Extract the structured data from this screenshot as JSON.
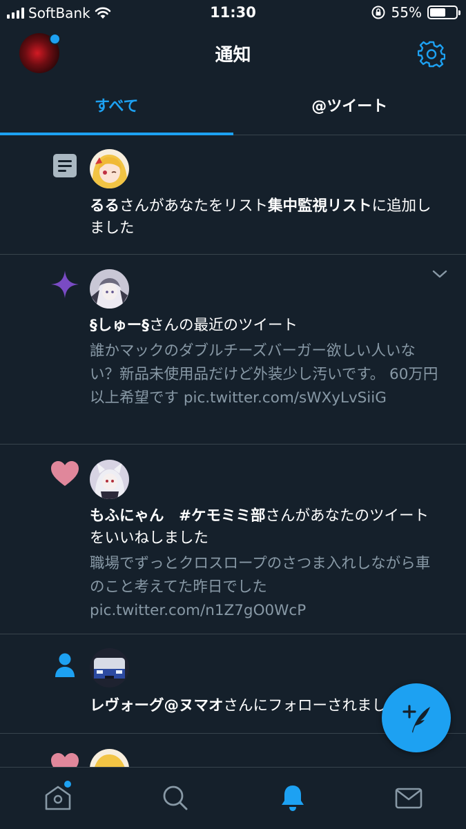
{
  "status_bar": {
    "carrier": "SoftBank",
    "time": "11:30",
    "battery": "55%"
  },
  "header": {
    "title": "通知"
  },
  "tabs": [
    {
      "label": "すべて",
      "active": true
    },
    {
      "label": "@ツイート",
      "active": false
    }
  ],
  "notifications": [
    {
      "type": "list-add",
      "name": "るる",
      "text_mid": "さんがあなたをリスト",
      "list_name": "集中監視リスト",
      "text_end": "に追加しました"
    },
    {
      "type": "recent-tweet",
      "name": "§しゅー§",
      "text_end": "さんの最近のツイート",
      "body": "誰かマックのダブルチーズバーガー欲しい人いない？新品未使用品だけど外装少し汚いです。 60万円以上希望です pic.twitter.com/sWXyLvSiiG"
    },
    {
      "type": "like",
      "name": "もふにゃん　#ケモミミ部",
      "text_end": "さんがあなたのツイートをいいねしました",
      "body": "職場でずっとクロスロープのさつま入れしながら車のこと考えてた昨日でした pic.twitter.com/n1Z7gO0WcP"
    },
    {
      "type": "follow",
      "name": "レヴォーグ@ヌマオ",
      "text_end": "さんにフォローされました"
    },
    {
      "type": "like"
    }
  ],
  "colors": {
    "background": "#15202b",
    "accent": "#1da1f2",
    "like": "#e0879b",
    "spark": "#794bc4",
    "muted": "#8899a6"
  }
}
